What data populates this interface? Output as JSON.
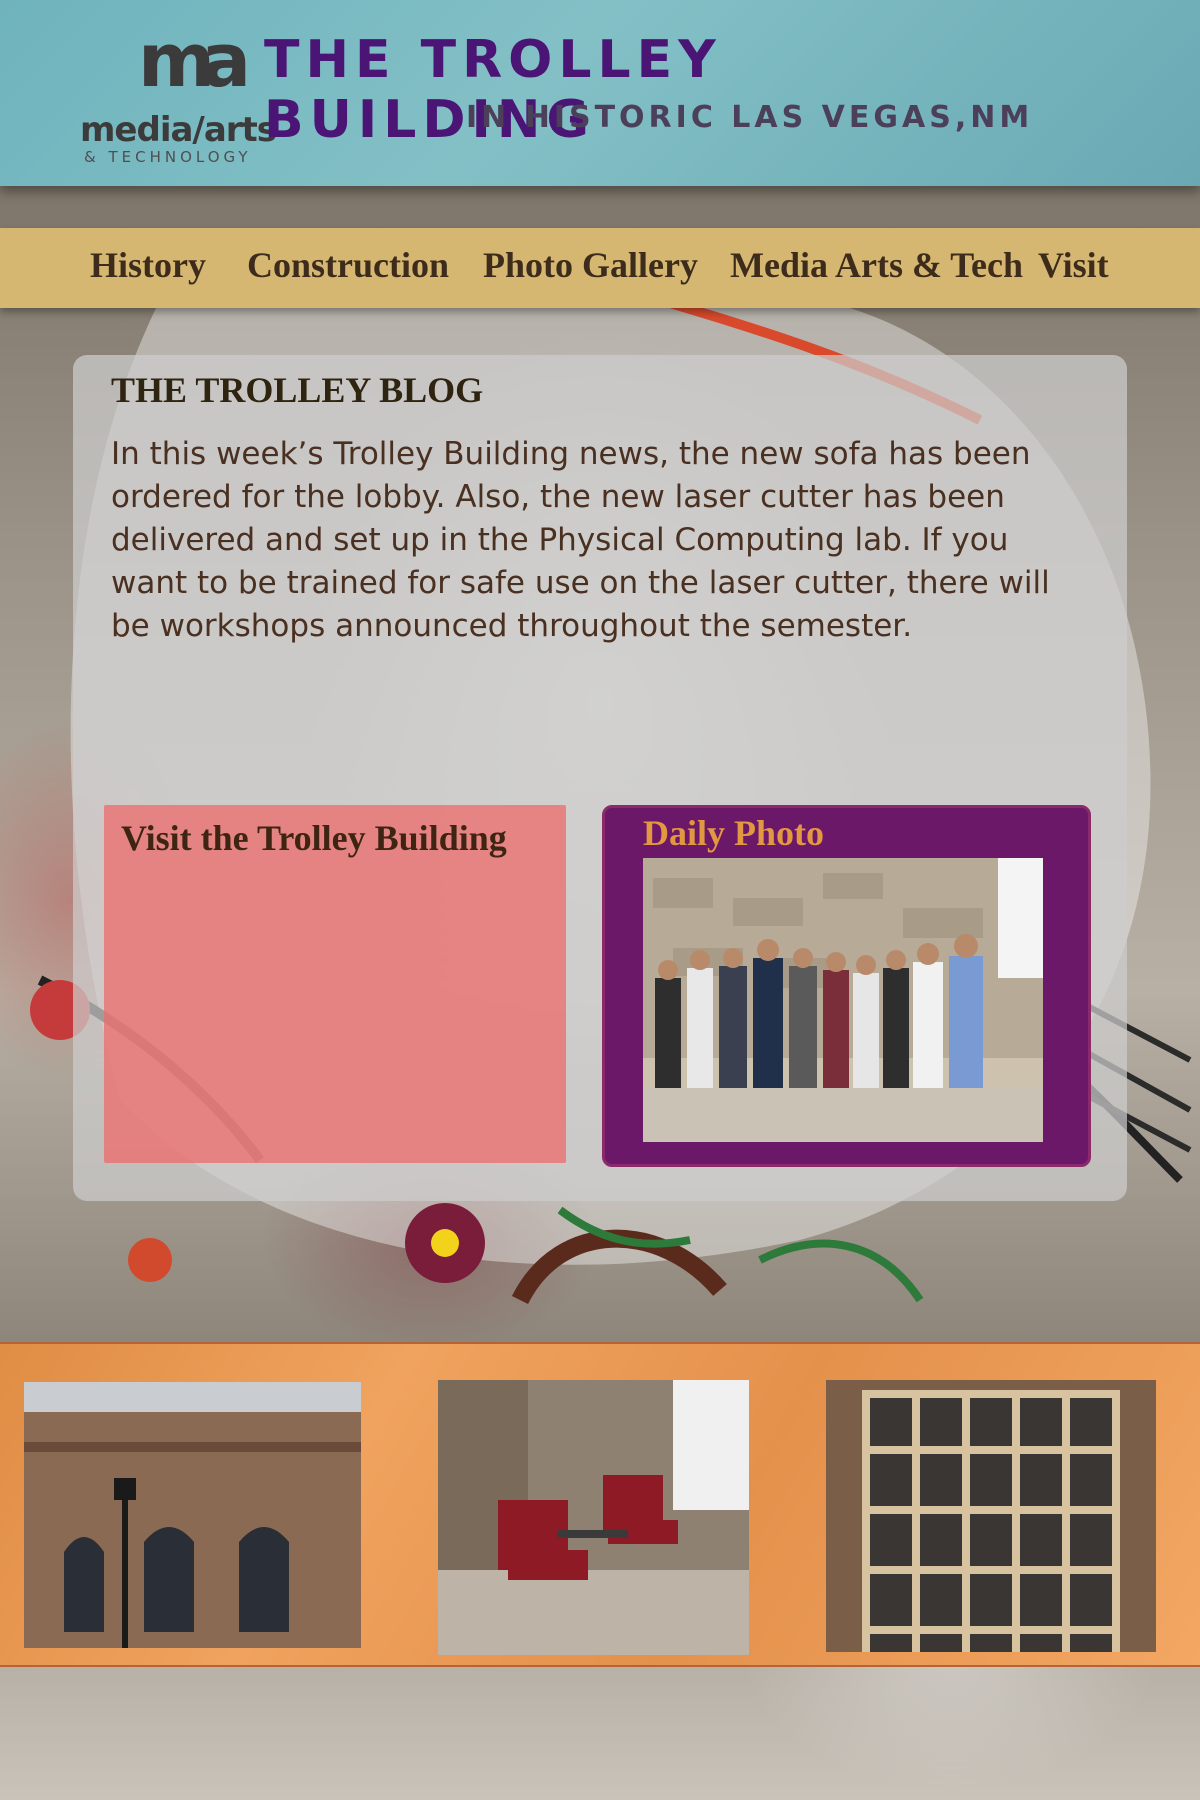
{
  "header": {
    "logo_mark": "ma",
    "logo_word": "media/arts",
    "logo_sub": "& TECHNOLOGY",
    "title": "THE TROLLEY BUILDING",
    "subtitle": "IN HISTORIC LAS VEGAS,NM"
  },
  "nav": {
    "items": [
      {
        "label": "History"
      },
      {
        "label": "Construction"
      },
      {
        "label": "Photo Gallery"
      },
      {
        "label": "Media Arts & Tech"
      },
      {
        "label": "Visit"
      }
    ]
  },
  "blog": {
    "title": "THE TROLLEY BLOG",
    "body": "In this week’s Trolley Building news, the new sofa has been ordered for the lobby. Also, the new laser cutter has been delivered and set up in the Physical Computing lab. If you want to be trained for safe use on the laser cutter, there will be workshops announced throughout the semester."
  },
  "visit_box": {
    "title": "Visit the Trolley Building"
  },
  "daily_photo": {
    "title": "Daily Photo"
  },
  "colors": {
    "header_bg": "#7ab9c1",
    "title_purple": "#4b1575",
    "nav_gold": "#d6b771",
    "visit_pink": "#ec6e6e",
    "photo_purple": "#6c1868",
    "photo_title_orange": "#e29840",
    "strip_orange": "#e8964f"
  }
}
